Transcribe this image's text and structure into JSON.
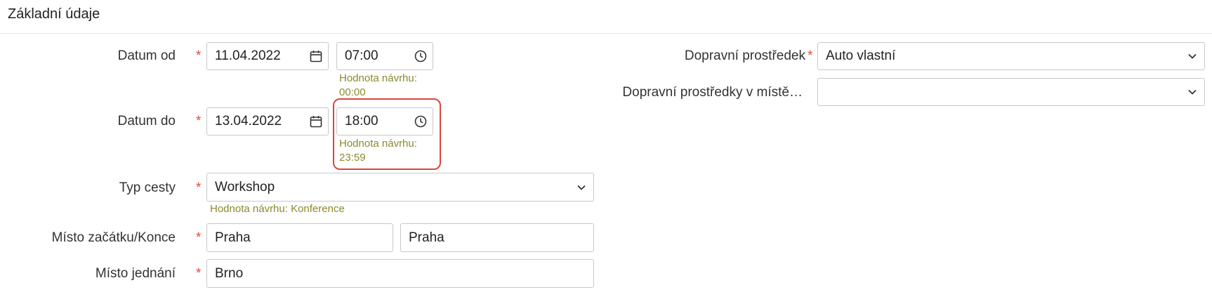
{
  "section": {
    "title": "Základní údaje"
  },
  "required_mark": "*",
  "datum_od": {
    "label": "Datum od",
    "date": "11.04.2022",
    "time": "07:00",
    "hint_line1": "Hodnota návrhu:",
    "hint_line2": "00:00"
  },
  "datum_do": {
    "label": "Datum do",
    "date": "13.04.2022",
    "time": "18:00",
    "hint_line1": "Hodnota návrhu:",
    "hint_line2": "23:59"
  },
  "typ_cesty": {
    "label": "Typ cesty",
    "value": "Workshop",
    "hint": "Hodnota návrhu: Konference"
  },
  "misto_zacatku": {
    "label": "Místo začátku/Konce",
    "start": "Praha",
    "end": "Praha"
  },
  "misto_jednani": {
    "label": "Místo jednání",
    "value": "Brno"
  },
  "dopravni_prostredek": {
    "label": "Dopravní prostředek",
    "value": "Auto vlastní"
  },
  "dopravni_prostredky_miste": {
    "label": "Dopravní prostředky v místě…",
    "value": ""
  },
  "colors": {
    "required": "#e0493a",
    "hint": "#8b8a2e",
    "highlight": "#d8473a"
  }
}
